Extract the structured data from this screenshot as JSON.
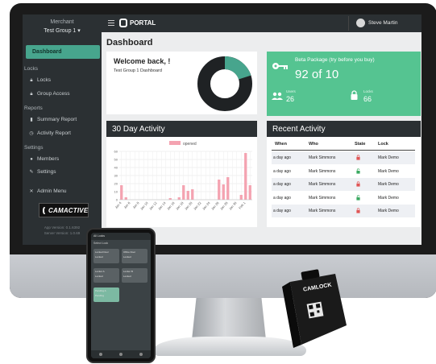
{
  "sidebar": {
    "merchant_label": "Merchant",
    "group_select": "Test Group 1 ▾",
    "dashboard": "Dashboard",
    "sections": {
      "locks": "Locks",
      "reports": "Reports",
      "settings": "Settings"
    },
    "items": {
      "locks": "Locks",
      "group_access": "Group Access",
      "summary_report": "Summary Report",
      "activity_report": "Activity Report",
      "members": "Members",
      "settings": "Settings",
      "admin_menu": "Admin Menu"
    },
    "logo_text": "CAMACTIVE",
    "app_version": "App Version: 0.1.6392",
    "server_version": "Server Version: 1.0.69"
  },
  "topbar": {
    "portal": "PORTAL",
    "user": "Steve Martin"
  },
  "page_title": "Dashboard",
  "welcome": {
    "title": "Welcome back, !",
    "subtitle": "Test Group 1 Dashboard",
    "donut_fraction": 0.2
  },
  "beta": {
    "title": "Beta Package (try before you buy)",
    "count": "92 of 10",
    "users_label": "Users",
    "users_value": "26",
    "locks_label": "Locks",
    "locks_value": "66"
  },
  "activity": {
    "title": "30 Day Activity"
  },
  "recent": {
    "title": "Recent Activity",
    "headers": [
      "When",
      "Who",
      "State",
      "Lock"
    ],
    "rows": [
      {
        "when": "a day ago",
        "who": "Mark Simmons",
        "state": "locked",
        "lock": "Mark Demo"
      },
      {
        "when": "a day ago",
        "who": "Mark Simmons",
        "state": "unlocked",
        "lock": "Mark Demo"
      },
      {
        "when": "a day ago",
        "who": "Mark Simmons",
        "state": "locked",
        "lock": "Mark Demo"
      },
      {
        "when": "a day ago",
        "who": "Mark Simmons",
        "state": "unlocked",
        "lock": "Mark Demo"
      },
      {
        "when": "a day ago",
        "who": "Mark Simmons",
        "state": "locked",
        "lock": "Mark Demo"
      }
    ]
  },
  "colors": {
    "accent": "#47a58d",
    "beta_green": "#55c491",
    "bar_pink": "#f4a3b1",
    "dark": "#2b3033",
    "lock_red": "#e05555",
    "unlock_green": "#3aa860"
  },
  "chart_data": {
    "type": "bar",
    "title": "",
    "legend": [
      "opened"
    ],
    "legend_position": "top",
    "ylim": [
      0,
      60
    ],
    "yticks": [
      "0",
      "10",
      "20",
      "30",
      "40",
      "50",
      "60"
    ],
    "categories": [
      "Jan 4",
      "Jan 5",
      "Jan 6",
      "Jan 7",
      "Jan 8",
      "Jan 9",
      "Jan 10",
      "Jan 11",
      "Jan 12",
      "Jan 13",
      "Jan 14",
      "Jan 15",
      "Jan 16",
      "Jan 17",
      "Jan 18",
      "Jan 19",
      "Jan 20",
      "Jan 21",
      "Jan 22",
      "Jan 23",
      "Jan 24",
      "Jan 25",
      "Jan 26",
      "Jan 27",
      "Jan 28",
      "Jan 29",
      "Jan 30",
      "Jan 31",
      "Feb 1",
      "Feb 2"
    ],
    "xticks": [
      "Jan 4",
      "Jan 6",
      "Jan 8",
      "Jan 10",
      "Jan 12",
      "Jan 14",
      "Jan 16",
      "Jan 18",
      "Jan 20",
      "Jan 22",
      "Jan 24",
      "Jan 26",
      "Jan 28",
      "Jan 30",
      "Feb 1"
    ],
    "series": [
      {
        "name": "opened",
        "values": [
          18,
          3,
          0,
          0,
          0,
          0,
          0,
          0,
          0,
          0,
          0,
          2,
          0,
          3,
          18,
          11,
          13,
          0,
          0,
          0,
          0,
          0,
          25,
          19,
          28,
          0,
          0,
          6,
          58,
          18
        ]
      }
    ],
    "grid": true
  },
  "phone": {
    "header": "All Locks",
    "subheader": "Select Lock",
    "tiles": [
      {
        "name": "Locked Door",
        "state": "Locked"
      },
      {
        "name": "Office Door",
        "state": "Locked"
      },
      {
        "name": "Locker A",
        "state": "Locked"
      },
      {
        "name": "Locker B",
        "state": "Locked"
      },
      {
        "name": "Pending A",
        "state": "Pending"
      }
    ]
  },
  "device": {
    "brand": "CAMLOCK"
  }
}
